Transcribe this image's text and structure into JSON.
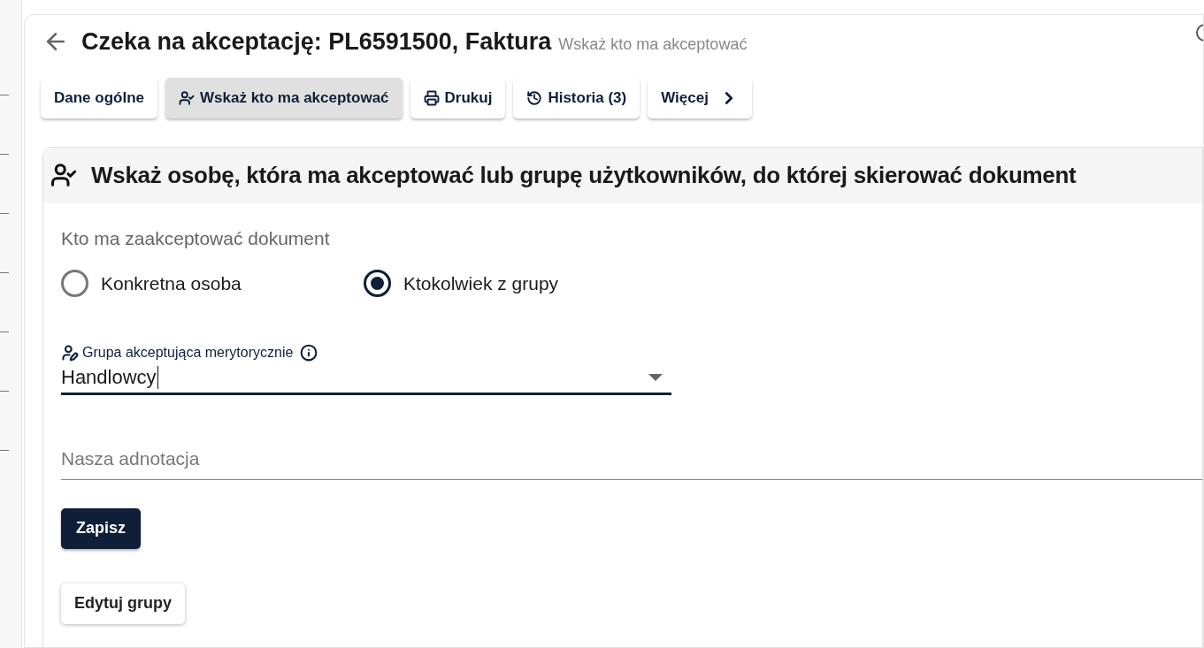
{
  "header": {
    "title": "Czeka na akceptację: PL6591500, Faktura",
    "subtitle": "Wskaż kto ma akceptować"
  },
  "tabs": [
    {
      "label": "Dane ogólne",
      "kind": "plain",
      "selected": false
    },
    {
      "label": "Wskaż kto ma akceptować",
      "kind": "person",
      "selected": true
    },
    {
      "label": "Drukuj",
      "kind": "print",
      "selected": false
    },
    {
      "label": "Historia (3)",
      "kind": "history",
      "selected": false
    },
    {
      "label": "Więcej",
      "kind": "more",
      "selected": false
    }
  ],
  "panel": {
    "heading": "Wskaż osobę, która ma akceptować lub grupę użytkowników, do której skierować dokument",
    "question": "Kto ma zaakceptować dokument",
    "options": [
      {
        "label": "Konkretna osoba",
        "selected": false
      },
      {
        "label": "Ktokolwiek z grupy",
        "selected": true
      }
    ],
    "group_field": {
      "label": "Grupa akceptująca merytorycznie",
      "value": "Handlowcy"
    },
    "note_field": {
      "placeholder": "Nasza adnotacja"
    },
    "save_button": "Zapisz",
    "edit_button": "Edytuj grupy"
  }
}
